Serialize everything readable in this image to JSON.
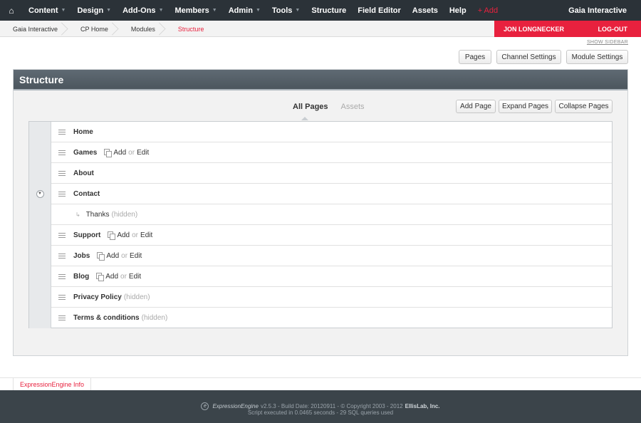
{
  "nav": {
    "items": [
      {
        "label": "Content",
        "has_menu": true
      },
      {
        "label": "Design",
        "has_menu": true
      },
      {
        "label": "Add-Ons",
        "has_menu": true
      },
      {
        "label": "Members",
        "has_menu": true
      },
      {
        "label": "Admin",
        "has_menu": true
      },
      {
        "label": "Tools",
        "has_menu": true
      },
      {
        "label": "Structure",
        "has_menu": false
      },
      {
        "label": "Field Editor",
        "has_menu": false
      },
      {
        "label": "Assets",
        "has_menu": false
      },
      {
        "label": "Help",
        "has_menu": false
      }
    ],
    "add_label": "+ Add",
    "site_name": "Gaia Interactive",
    "caret": "▼",
    "home_icon": "⌂"
  },
  "breadcrumb": [
    "Gaia Interactive",
    "CP Home",
    "Modules",
    "Structure"
  ],
  "user": {
    "name": "JON LONGNECKER",
    "logout": "LOG-OUT"
  },
  "show_sidebar": "SHOW SIDEBAR",
  "top_buttons": {
    "pages": "Pages",
    "channel_settings": "Channel Settings",
    "module_settings": "Module Settings"
  },
  "panel": {
    "title": "Structure",
    "tabs": {
      "all_pages": "All Pages",
      "assets": "Assets"
    },
    "actions": {
      "add_page": "Add Page",
      "expand": "Expand Pages",
      "collapse": "Collapse Pages"
    },
    "add_label": "Add",
    "or_label": "or",
    "edit_label": "Edit",
    "pages": [
      {
        "title": "Home",
        "hidden": "",
        "add_edit": false,
        "toggle": false,
        "child": false
      },
      {
        "title": "Games",
        "hidden": "",
        "add_edit": true,
        "toggle": false,
        "child": false
      },
      {
        "title": "About",
        "hidden": "",
        "add_edit": false,
        "toggle": false,
        "child": false
      },
      {
        "title": "Contact",
        "hidden": "",
        "add_edit": false,
        "toggle": true,
        "child": false
      },
      {
        "title": "Thanks",
        "hidden": "(hidden)",
        "add_edit": false,
        "toggle": false,
        "child": true
      },
      {
        "title": "Support",
        "hidden": "",
        "add_edit": true,
        "toggle": false,
        "child": false
      },
      {
        "title": "Jobs",
        "hidden": "",
        "add_edit": true,
        "toggle": false,
        "child": false
      },
      {
        "title": "Blog",
        "hidden": "",
        "add_edit": true,
        "toggle": false,
        "child": false
      },
      {
        "title": "Privacy Policy",
        "hidden": "(hidden)",
        "add_edit": false,
        "toggle": false,
        "child": false
      },
      {
        "title": "Terms & conditions",
        "hidden": "(hidden)",
        "add_edit": false,
        "toggle": false,
        "child": false
      }
    ]
  },
  "footer": {
    "info_tab": "ExpressionEngine Info",
    "brand": "ExpressionEngine",
    "version_text": "v2.5.3 - Build Date: 20120911 - © Copyright 2003 - 2012",
    "company": "EllisLab, Inc.",
    "script_text": "Script executed in 0.0465 seconds - 29 SQL queries used"
  }
}
